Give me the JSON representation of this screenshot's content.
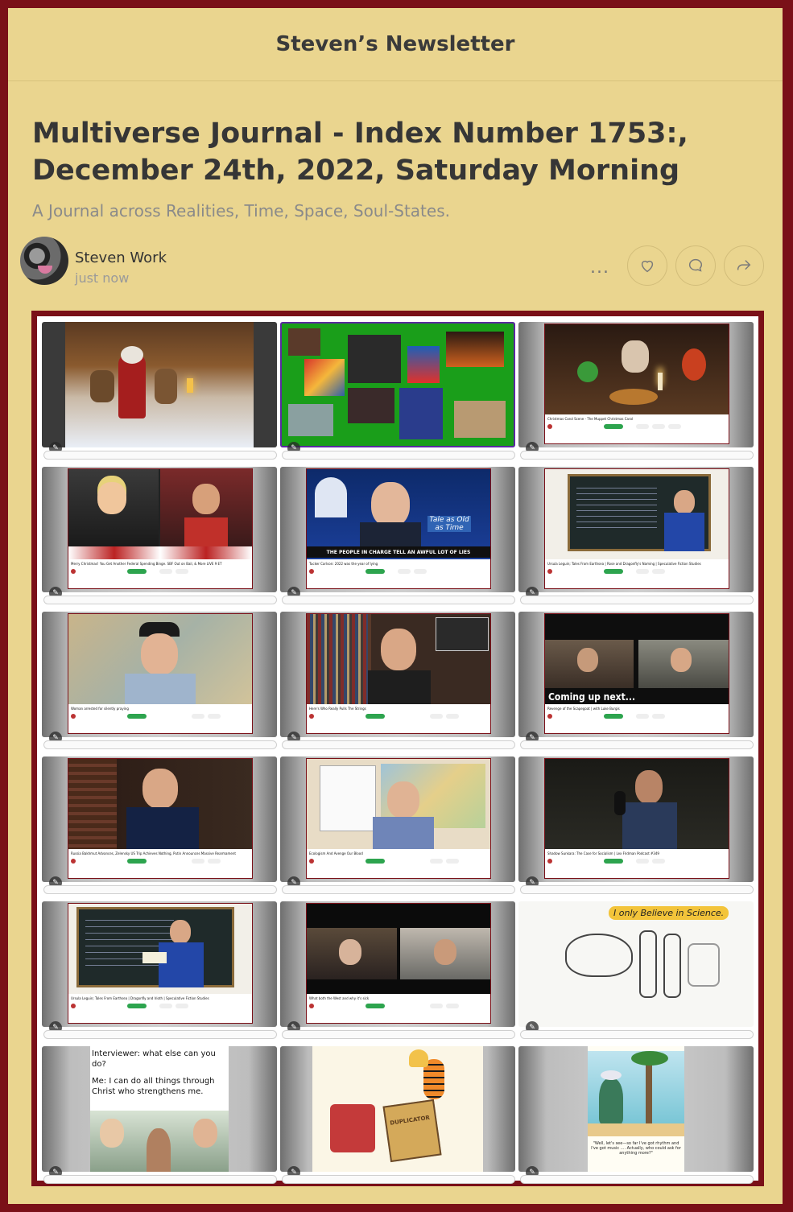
{
  "publication": {
    "name": "Steven’s Newsletter"
  },
  "post": {
    "title": "Multiverse Journal - Index Number 1753:, December 24th, 2022, Saturday Morning",
    "subtitle": "A Journal across Realities, Time, Space, Soul-States.",
    "author": "Steven Work",
    "time": "just now"
  },
  "actions": {
    "more": "...",
    "icons": [
      "more-icon",
      "heart-icon",
      "comment-icon",
      "share-icon"
    ]
  },
  "gallery": {
    "tiles": [
      {
        "kind": "painting",
        "desc_icon": "santa-reindeer-painting"
      },
      {
        "kind": "collage",
        "desc_icon": "art-collage"
      },
      {
        "kind": "video",
        "title": "Christmas Carol Scene - The Muppet Christmas Carol"
      },
      {
        "kind": "video",
        "title": "Merry Christmas! You Get Another Federal Spending Binge. SBF Out on Bail, & More LIVE 9 ET"
      },
      {
        "kind": "video",
        "title": "Tucker Carlson: 2022 was the year of lying",
        "banner": "THE PEOPLE IN CHARGE TELL AN AWFUL LOT OF LIES",
        "bubble": "Tale as Old as Time"
      },
      {
        "kind": "video",
        "title": "Ursula Leguin; Tales From Earthsea | Rose and Dragonfly's Naming | Speculative Fiction Studies"
      },
      {
        "kind": "video",
        "title": "Woman arrested for silently praying"
      },
      {
        "kind": "video",
        "title": "Here's Who Really Pulls The Strings"
      },
      {
        "kind": "video",
        "title": "Revenge of the Scapegoat | with Luke Burgis",
        "overlay": "Coming up next..."
      },
      {
        "kind": "video",
        "title": "Russia Bakhmut Advances, Zelensky US Trip Achieves Nothing, Putin Announces Massive Rearmament"
      },
      {
        "kind": "video",
        "title": "Ecologism And Avenge Our Blood"
      },
      {
        "kind": "video",
        "title": "Shadow Sunkara: The Case for Socialism | Lex Fridman Podcast #349"
      },
      {
        "kind": "video",
        "title": "Ursula Leguin; Tales From Earthsea | Dragonfly and Irioth | Speculative Fiction Studies"
      },
      {
        "kind": "video",
        "title": "What both the West and why it's sick"
      },
      {
        "kind": "cartoon",
        "caption": "I only Believe in Science."
      },
      {
        "kind": "meme",
        "lines": [
          "Interviewer: what else can you do?",
          "Me: I can do all things through Christ who strengthens me."
        ]
      },
      {
        "kind": "comic",
        "sign": "DUPLICATOR"
      },
      {
        "kind": "cartoon2",
        "caption": "\"Well, let's see—so far I've got rhythm and I've got music .... Actually, who could ask for anything more?\""
      }
    ]
  }
}
